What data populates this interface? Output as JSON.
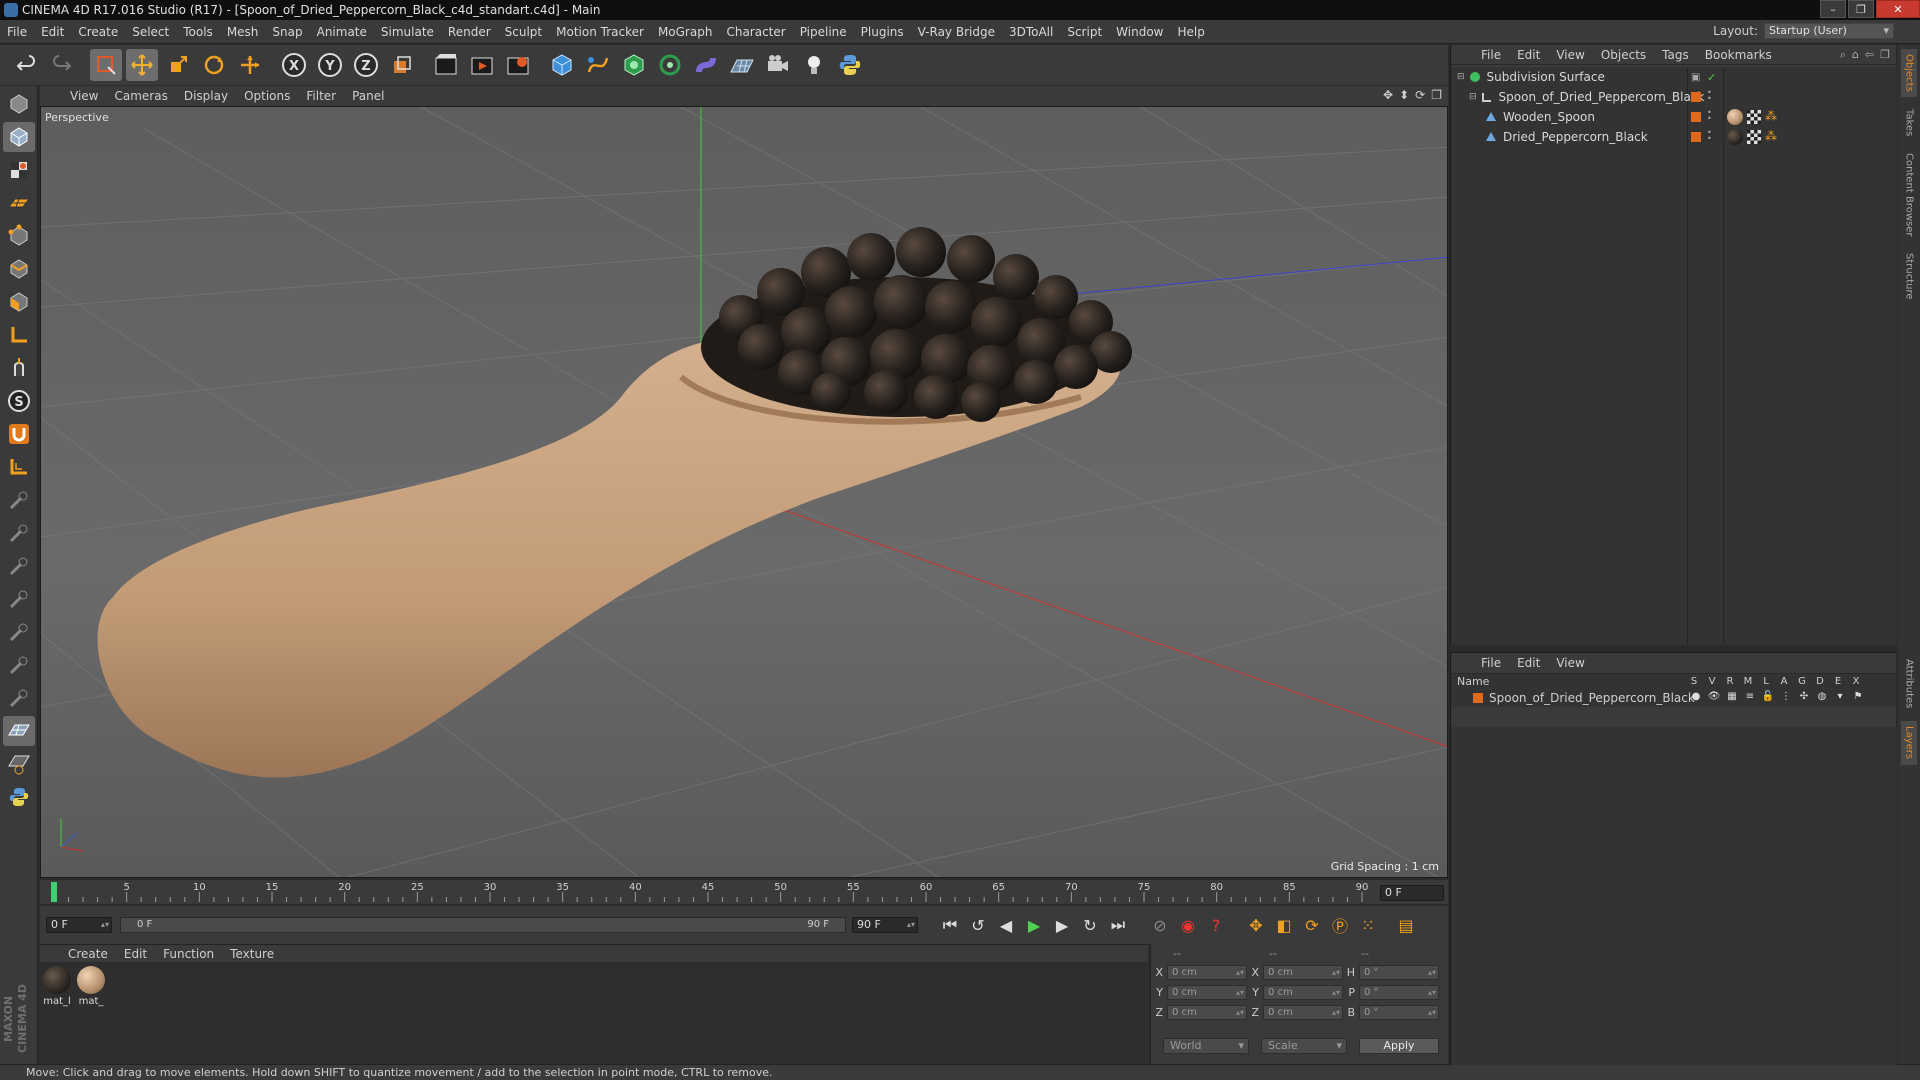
{
  "window": {
    "title": "CINEMA 4D R17.016 Studio (R17) - [Spoon_of_Dried_Peppercorn_Black_c4d_standart.c4d] - Main",
    "controls": [
      "–",
      "❐",
      "✕"
    ]
  },
  "menubar": {
    "items": [
      "File",
      "Edit",
      "Create",
      "Select",
      "Tools",
      "Mesh",
      "Snap",
      "Animate",
      "Simulate",
      "Render",
      "Sculpt",
      "Motion Tracker",
      "MoGraph",
      "Character",
      "Pipeline",
      "Plugins",
      "V-Ray Bridge",
      "3DToAll",
      "Script",
      "Window",
      "Help"
    ],
    "layout_label": "Layout:",
    "layout_value": "Startup (User)"
  },
  "viewport": {
    "menu": [
      "View",
      "Cameras",
      "Display",
      "Options",
      "Filter",
      "Panel"
    ],
    "camera_label": "Perspective",
    "grid_spacing": "Grid Spacing : 1 cm",
    "nav_icons": [
      "✥",
      "⬍",
      "⟳",
      "❐"
    ]
  },
  "timeline": {
    "ticks": [
      "0",
      "5",
      "10",
      "15",
      "20",
      "25",
      "30",
      "35",
      "40",
      "45",
      "50",
      "55",
      "60",
      "65",
      "70",
      "75",
      "80",
      "85",
      "90"
    ],
    "current_frame": "0 F"
  },
  "transport": {
    "start_field": "0 F",
    "range_start": "0 F",
    "range_end": "90 F",
    "end_field": "90 F"
  },
  "material_panel": {
    "menu": [
      "Create",
      "Edit",
      "Function",
      "Texture"
    ],
    "materials": [
      {
        "label": "mat_l",
        "color": "#2b2622"
      },
      {
        "label": "mat_",
        "color": "#b58f6a"
      }
    ]
  },
  "coordinates": {
    "headers": [
      "--",
      "--",
      "--"
    ],
    "rows": [
      {
        "a1": "X",
        "v1": "0 cm",
        "a2": "X",
        "v2": "0 cm",
        "a3": "H",
        "v3": "0 °"
      },
      {
        "a1": "Y",
        "v1": "0 cm",
        "a2": "Y",
        "v2": "0 cm",
        "a3": "P",
        "v3": "0 °"
      },
      {
        "a1": "Z",
        "v1": "0 cm",
        "a2": "Z",
        "v2": "0 cm",
        "a3": "B",
        "v3": "0 °"
      }
    ],
    "space": "World",
    "mode": "Scale",
    "apply": "Apply"
  },
  "object_manager": {
    "menu": [
      "File",
      "Edit",
      "View",
      "Objects",
      "Tags",
      "Bookmarks"
    ],
    "objects": [
      {
        "name": "Subdivision Surface"
      },
      {
        "name": "Spoon_of_Dried_Peppercorn_Black"
      },
      {
        "name": "Wooden_Spoon"
      },
      {
        "name": "Dried_Peppercorn_Black"
      }
    ]
  },
  "layer_manager": {
    "menu": [
      "File",
      "Edit",
      "View"
    ],
    "name_col": "Name",
    "cols": [
      "S",
      "V",
      "R",
      "M",
      "L",
      "A",
      "G",
      "D",
      "E",
      "X"
    ],
    "layers": [
      {
        "name": "Spoon_of_Dried_Peppercorn_Black"
      }
    ]
  },
  "right_tabs": [
    "Objects",
    "Takes",
    "Content Browser",
    "Structure",
    "Attributes",
    "Layers"
  ],
  "status": "Move: Click and drag to move elements. Hold down SHIFT to quantize movement / add to the selection in point mode, CTRL to remove.",
  "branding": "MAXON CINEMA 4D",
  "colors": {
    "accent": "#e06a1c",
    "bg": "#3a3a3a",
    "viewport": "#636363"
  }
}
